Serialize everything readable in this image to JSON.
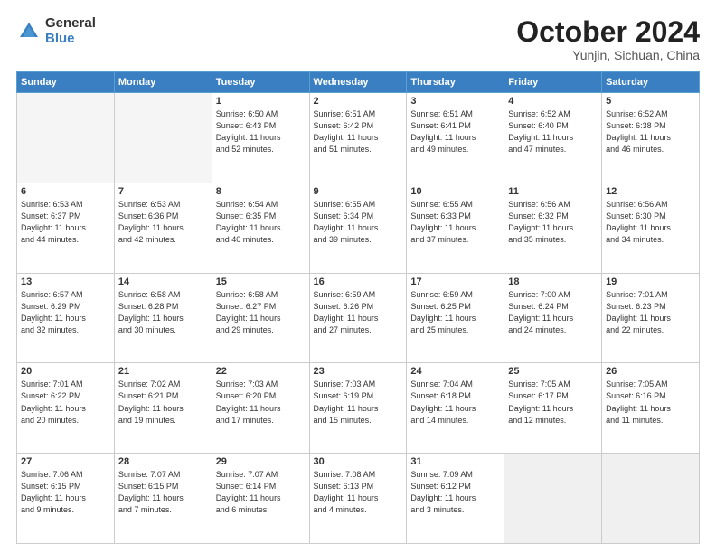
{
  "logo": {
    "general": "General",
    "blue": "Blue"
  },
  "title": "October 2024",
  "location": "Yunjin, Sichuan, China",
  "days_of_week": [
    "Sunday",
    "Monday",
    "Tuesday",
    "Wednesday",
    "Thursday",
    "Friday",
    "Saturday"
  ],
  "weeks": [
    [
      {
        "day": "",
        "info": ""
      },
      {
        "day": "",
        "info": ""
      },
      {
        "day": "1",
        "info": "Sunrise: 6:50 AM\nSunset: 6:43 PM\nDaylight: 11 hours\nand 52 minutes."
      },
      {
        "day": "2",
        "info": "Sunrise: 6:51 AM\nSunset: 6:42 PM\nDaylight: 11 hours\nand 51 minutes."
      },
      {
        "day": "3",
        "info": "Sunrise: 6:51 AM\nSunset: 6:41 PM\nDaylight: 11 hours\nand 49 minutes."
      },
      {
        "day": "4",
        "info": "Sunrise: 6:52 AM\nSunset: 6:40 PM\nDaylight: 11 hours\nand 47 minutes."
      },
      {
        "day": "5",
        "info": "Sunrise: 6:52 AM\nSunset: 6:38 PM\nDaylight: 11 hours\nand 46 minutes."
      }
    ],
    [
      {
        "day": "6",
        "info": "Sunrise: 6:53 AM\nSunset: 6:37 PM\nDaylight: 11 hours\nand 44 minutes."
      },
      {
        "day": "7",
        "info": "Sunrise: 6:53 AM\nSunset: 6:36 PM\nDaylight: 11 hours\nand 42 minutes."
      },
      {
        "day": "8",
        "info": "Sunrise: 6:54 AM\nSunset: 6:35 PM\nDaylight: 11 hours\nand 40 minutes."
      },
      {
        "day": "9",
        "info": "Sunrise: 6:55 AM\nSunset: 6:34 PM\nDaylight: 11 hours\nand 39 minutes."
      },
      {
        "day": "10",
        "info": "Sunrise: 6:55 AM\nSunset: 6:33 PM\nDaylight: 11 hours\nand 37 minutes."
      },
      {
        "day": "11",
        "info": "Sunrise: 6:56 AM\nSunset: 6:32 PM\nDaylight: 11 hours\nand 35 minutes."
      },
      {
        "day": "12",
        "info": "Sunrise: 6:56 AM\nSunset: 6:30 PM\nDaylight: 11 hours\nand 34 minutes."
      }
    ],
    [
      {
        "day": "13",
        "info": "Sunrise: 6:57 AM\nSunset: 6:29 PM\nDaylight: 11 hours\nand 32 minutes."
      },
      {
        "day": "14",
        "info": "Sunrise: 6:58 AM\nSunset: 6:28 PM\nDaylight: 11 hours\nand 30 minutes."
      },
      {
        "day": "15",
        "info": "Sunrise: 6:58 AM\nSunset: 6:27 PM\nDaylight: 11 hours\nand 29 minutes."
      },
      {
        "day": "16",
        "info": "Sunrise: 6:59 AM\nSunset: 6:26 PM\nDaylight: 11 hours\nand 27 minutes."
      },
      {
        "day": "17",
        "info": "Sunrise: 6:59 AM\nSunset: 6:25 PM\nDaylight: 11 hours\nand 25 minutes."
      },
      {
        "day": "18",
        "info": "Sunrise: 7:00 AM\nSunset: 6:24 PM\nDaylight: 11 hours\nand 24 minutes."
      },
      {
        "day": "19",
        "info": "Sunrise: 7:01 AM\nSunset: 6:23 PM\nDaylight: 11 hours\nand 22 minutes."
      }
    ],
    [
      {
        "day": "20",
        "info": "Sunrise: 7:01 AM\nSunset: 6:22 PM\nDaylight: 11 hours\nand 20 minutes."
      },
      {
        "day": "21",
        "info": "Sunrise: 7:02 AM\nSunset: 6:21 PM\nDaylight: 11 hours\nand 19 minutes."
      },
      {
        "day": "22",
        "info": "Sunrise: 7:03 AM\nSunset: 6:20 PM\nDaylight: 11 hours\nand 17 minutes."
      },
      {
        "day": "23",
        "info": "Sunrise: 7:03 AM\nSunset: 6:19 PM\nDaylight: 11 hours\nand 15 minutes."
      },
      {
        "day": "24",
        "info": "Sunrise: 7:04 AM\nSunset: 6:18 PM\nDaylight: 11 hours\nand 14 minutes."
      },
      {
        "day": "25",
        "info": "Sunrise: 7:05 AM\nSunset: 6:17 PM\nDaylight: 11 hours\nand 12 minutes."
      },
      {
        "day": "26",
        "info": "Sunrise: 7:05 AM\nSunset: 6:16 PM\nDaylight: 11 hours\nand 11 minutes."
      }
    ],
    [
      {
        "day": "27",
        "info": "Sunrise: 7:06 AM\nSunset: 6:15 PM\nDaylight: 11 hours\nand 9 minutes."
      },
      {
        "day": "28",
        "info": "Sunrise: 7:07 AM\nSunset: 6:15 PM\nDaylight: 11 hours\nand 7 minutes."
      },
      {
        "day": "29",
        "info": "Sunrise: 7:07 AM\nSunset: 6:14 PM\nDaylight: 11 hours\nand 6 minutes."
      },
      {
        "day": "30",
        "info": "Sunrise: 7:08 AM\nSunset: 6:13 PM\nDaylight: 11 hours\nand 4 minutes."
      },
      {
        "day": "31",
        "info": "Sunrise: 7:09 AM\nSunset: 6:12 PM\nDaylight: 11 hours\nand 3 minutes."
      },
      {
        "day": "",
        "info": ""
      },
      {
        "day": "",
        "info": ""
      }
    ]
  ]
}
